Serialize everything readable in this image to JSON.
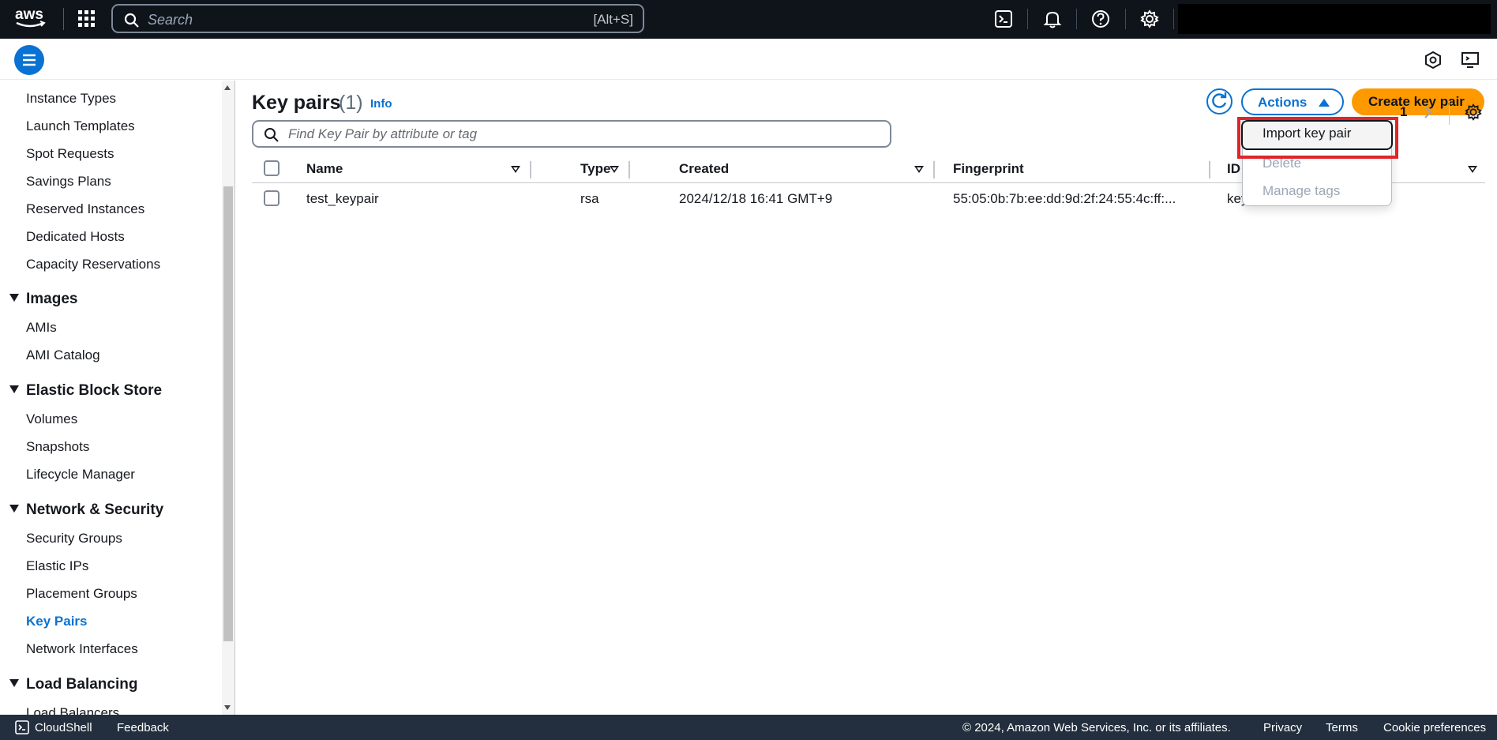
{
  "topbar": {
    "search_placeholder": "Search",
    "search_shortcut": "[Alt+S]",
    "icons": [
      "aws-logo",
      "grid-icon",
      "search-icon",
      "cloudshell-icon",
      "bell-icon",
      "help-icon",
      "gear-icon"
    ]
  },
  "subbar": {
    "icons": [
      "menu-icon",
      "hexagon-settings-icon",
      "monitor-icon"
    ]
  },
  "sidebar": {
    "items_top": [
      "Instance Types",
      "Launch Templates",
      "Spot Requests",
      "Savings Plans",
      "Reserved Instances",
      "Dedicated Hosts",
      "Capacity Reservations"
    ],
    "sections": [
      {
        "title": "Images",
        "items": [
          "AMIs",
          "AMI Catalog"
        ]
      },
      {
        "title": "Elastic Block Store",
        "items": [
          "Volumes",
          "Snapshots",
          "Lifecycle Manager"
        ]
      },
      {
        "title": "Network & Security",
        "items": [
          "Security Groups",
          "Elastic IPs",
          "Placement Groups",
          "Key Pairs",
          "Network Interfaces"
        ]
      },
      {
        "title": "Load Balancing",
        "items": [
          "Load Balancers"
        ]
      }
    ],
    "active_item": "Key Pairs"
  },
  "main": {
    "title": "Key pairs",
    "count": "(1)",
    "info": "Info",
    "actions_label": "Actions",
    "create_label": "Create key pair",
    "filter_placeholder": "Find Key Pair by attribute or tag",
    "page_number": "1",
    "columns": [
      "Name",
      "Type",
      "Created",
      "Fingerprint",
      "ID"
    ],
    "rows": [
      {
        "name": "test_keypair",
        "type": "rsa",
        "created": "2024/12/18 16:41 GMT+9",
        "fingerprint": "55:05:0b:7b:ee:dd:9d:2f:24:55:4c:ff:...",
        "id": "key"
      }
    ]
  },
  "actions_menu": {
    "items": [
      "Import key pair",
      "Delete",
      "Manage tags"
    ]
  },
  "footer": {
    "cloudshell": "CloudShell",
    "feedback": "Feedback",
    "copyright": "© 2024, Amazon Web Services, Inc. or its affiliates.",
    "privacy": "Privacy",
    "terms": "Terms",
    "cookies": "Cookie preferences"
  },
  "colors": {
    "topbar_bg": "#0f141a",
    "accent_blue": "#0972d3",
    "primary_orange": "#ff9900",
    "highlight_red": "#e0242a",
    "footer_bg": "#232f3e"
  }
}
